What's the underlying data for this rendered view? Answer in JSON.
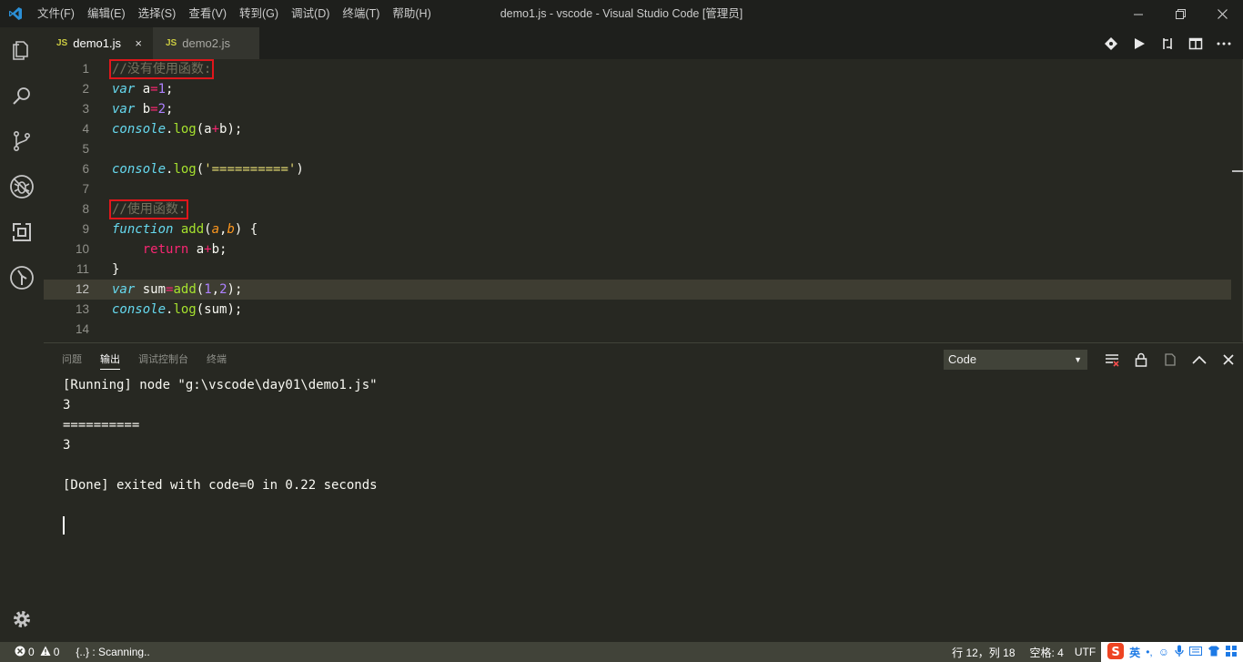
{
  "titlebar": {
    "menu": [
      "文件(F)",
      "编辑(E)",
      "选择(S)",
      "查看(V)",
      "转到(G)",
      "调试(D)",
      "终端(T)",
      "帮助(H)"
    ],
    "title": "demo1.js - vscode - Visual Studio Code [管理员]"
  },
  "tabs": [
    {
      "badge": "JS",
      "label": "demo1.js",
      "active": true,
      "close": "×"
    },
    {
      "badge": "JS",
      "label": "demo2.js",
      "active": false
    }
  ],
  "editor": {
    "current_line": 12,
    "line_numbers": [
      "1",
      "2",
      "3",
      "4",
      "5",
      "6",
      "7",
      "8",
      "9",
      "10",
      "11",
      "12",
      "13",
      "14"
    ],
    "code": {
      "l1_comment": "//没有使用函数:",
      "var": "var",
      "l2_name": "a",
      "eq": "=",
      "l2_val": "1",
      "semi": ";",
      "l3_name": "b",
      "l3_val": "2",
      "console": "console",
      "dot": ".",
      "log": "log",
      "l4_args": "(a",
      "plus": "+",
      "l4_rest": "b);",
      "l6_open": "(",
      "l6_str": "'=========='",
      "l6_close": ")",
      "l8_comment": "//使用函数:",
      "function": "function",
      "add": "add",
      "p_open": "(",
      "param_a": "a",
      "comma": ",",
      "param_b": "b",
      "p_close": ") {",
      "return": "return",
      "l10_a": "a",
      "l10_rest": "b;",
      "brace": "}",
      "sum": "sum",
      "one": "1",
      "two": "2",
      "l12_close": ");",
      "l13_args": "(sum);"
    }
  },
  "panel": {
    "tabs": [
      "问题",
      "输出",
      "调试控制台",
      "终端"
    ],
    "active_tab": "输出",
    "channel": "Code",
    "output": [
      "[Running] node \"g:\\vscode\\day01\\demo1.js\"",
      "3",
      "==========",
      "3",
      "",
      "[Done] exited with code=0 in 0.22 seconds"
    ]
  },
  "status": {
    "errors": "0",
    "warnings": "0",
    "scanning": "{..} : Scanning..",
    "position": "行 12，列 18",
    "spaces": "空格: 4",
    "encoding": "UTF",
    "ime_label": "英"
  },
  "colors": {
    "background": "#272822",
    "comment": "#75715e",
    "keyword": "#66d9ef",
    "operator": "#f92672",
    "number": "#ae81ff",
    "function": "#a6e22e",
    "string": "#e6db74",
    "parameter": "#fd971f",
    "highlight_box": "#e0161b"
  }
}
